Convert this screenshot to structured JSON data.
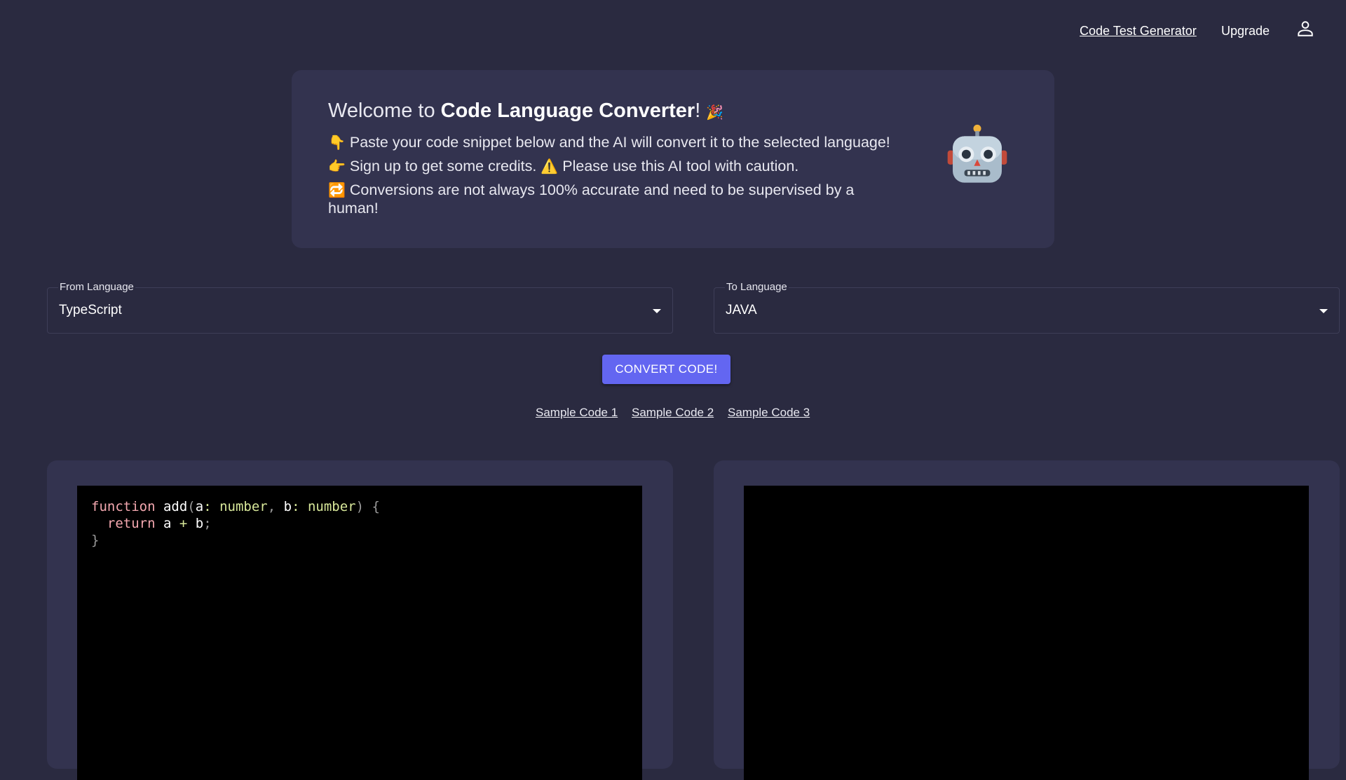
{
  "nav": {
    "code_test_generator": "Code Test Generator",
    "upgrade": "Upgrade",
    "user_icon": "user-icon"
  },
  "welcome": {
    "title_prefix": "Welcome to ",
    "title_bold": "Code Language Converter",
    "title_suffix": "! ",
    "title_emoji": "🎉",
    "line1_emoji": "👇",
    "line1": " Paste your code snippet below and the AI will convert it to the selected language!",
    "line2_emoji": "👉",
    "line2_a": " Sign up to get some credits. ",
    "line2_warn_emoji": "⚠️",
    "line2_b": " Please use this AI tool with caution.",
    "line3_emoji": "🔁",
    "line3": " Conversions are not always 100% accurate and need to be supervised by a human!",
    "robot_icon": "robot-icon"
  },
  "from_language": {
    "label": "From Language",
    "value": "TypeScript"
  },
  "to_language": {
    "label": "To Language",
    "value": "JAVA"
  },
  "convert_button": "CONVERT CODE!",
  "samples": [
    "Sample Code 1",
    "Sample Code 2",
    "Sample Code 3"
  ],
  "input_code": {
    "line1": {
      "kw": "function",
      "name": " add",
      "p1": "(",
      "a": "a",
      "c1": ": ",
      "t1": "number",
      "c2": ", ",
      "b": "b",
      "c3": ": ",
      "t2": "number",
      "p2": ") {"
    },
    "line2": {
      "indent": "  ",
      "kw": "return",
      "rest_a": " a ",
      "op": "+",
      "rest_b": " b",
      "semi": ";"
    },
    "line3": "}"
  },
  "output_code": "",
  "colors": {
    "background": "#2a2a40",
    "panel": "#33334f",
    "accent": "#6366f1",
    "editor": "#000000"
  }
}
